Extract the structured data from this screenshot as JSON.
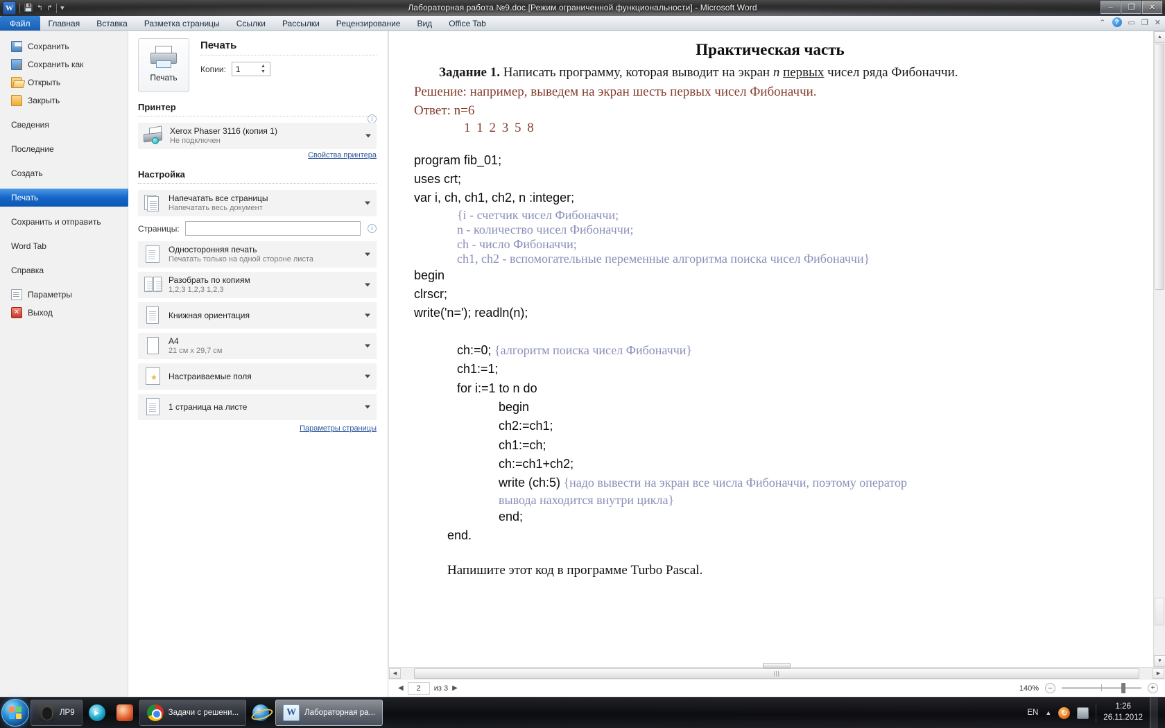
{
  "window": {
    "title": "Лабораторная работа №9.doc [Режим ограниченной функциональности]  -  Microsoft Word",
    "minimize": "–",
    "restore": "❐",
    "close": "✕"
  },
  "quick_access": {
    "orb": "W",
    "save": "💾",
    "undo": "↰",
    "redo": "↱",
    "more": "▾"
  },
  "ribbon": {
    "tabs": [
      {
        "label": "Файл",
        "active": true
      },
      {
        "label": "Главная",
        "active": false
      },
      {
        "label": "Вставка",
        "active": false
      },
      {
        "label": "Разметка страницы",
        "active": false
      },
      {
        "label": "Ссылки",
        "active": false
      },
      {
        "label": "Рассылки",
        "active": false
      },
      {
        "label": "Рецензирование",
        "active": false
      },
      {
        "label": "Вид",
        "active": false
      },
      {
        "label": "Office Tab",
        "active": false
      }
    ],
    "collapse": "⌃",
    "help": "?",
    "min": "▭",
    "restore": "❐",
    "close": "✕"
  },
  "backstage_nav": {
    "items": [
      {
        "label": "Сохранить",
        "icon": "save-icon",
        "selected": false
      },
      {
        "label": "Сохранить как",
        "icon": "save-as-icon",
        "selected": false
      },
      {
        "label": "Открыть",
        "icon": "open-folder-icon",
        "selected": false
      },
      {
        "label": "Закрыть",
        "icon": "close-folder-icon",
        "selected": false
      },
      {
        "label": "Сведения",
        "icon": "",
        "selected": false
      },
      {
        "label": "Последние",
        "icon": "",
        "selected": false
      },
      {
        "label": "Создать",
        "icon": "",
        "selected": false
      },
      {
        "label": "Печать",
        "icon": "",
        "selected": true
      },
      {
        "label": "Сохранить и отправить",
        "icon": "",
        "selected": false
      },
      {
        "label": "Word Tab",
        "icon": "",
        "selected": false
      },
      {
        "label": "Справка",
        "icon": "",
        "selected": false
      },
      {
        "label": "Параметры",
        "icon": "options-icon",
        "selected": false
      },
      {
        "label": "Выход",
        "icon": "exit-icon",
        "selected": false
      }
    ]
  },
  "print_panel": {
    "heading": "Печать",
    "print_button_label": "Печать",
    "copies_label": "Копии:",
    "copies_value": "1",
    "printer_heading": "Принтер",
    "printer_name": "Xerox Phaser 3116 (копия 1)",
    "printer_status": "Не подключен",
    "printer_properties_link": "Свойства принтера",
    "settings_heading": "Настройка",
    "options": [
      {
        "title": "Напечатать все страницы",
        "subtitle": "Напечатать весь документ",
        "icon": "pages-icon"
      },
      {
        "title": "Односторонняя печать",
        "subtitle": "Печатать только на одной стороне листа",
        "icon": "one-sided-icon"
      },
      {
        "title": "Разобрать по копиям",
        "subtitle": "1,2,3   1,2,3   1,2,3",
        "icon": "collate-icon"
      },
      {
        "title": "Книжная ориентация",
        "subtitle": "",
        "icon": "portrait-icon"
      },
      {
        "title": "A4",
        "subtitle": "21 см x 29,7 см",
        "icon": "paper-size-icon"
      },
      {
        "title": "Настраиваемые поля",
        "subtitle": "",
        "icon": "margins-icon"
      },
      {
        "title": "1 страница на листе",
        "subtitle": "",
        "icon": "pages-per-sheet-icon"
      }
    ],
    "pages_label": "Страницы:",
    "pages_value": "",
    "page_setup_link": "Параметры страницы",
    "info_glyph": "i"
  },
  "document": {
    "title": "Практическая часть",
    "task_prefix": "Задание 1.",
    "task_text_1": "Написать программу, которая выводит на экран",
    "task_italic": "n",
    "task_underlined": "первых",
    "task_text_2": "чисел ряда Фибоначчи.",
    "solution_line": "Решение: например, выведем на экран шесть первых чисел Фибоначчи.",
    "answer_line": "Ответ: n=6",
    "fib_sequence": "1 1 2 3 5 8",
    "code_lines": [
      {
        "text": "program fib_01;",
        "indent": 0,
        "type": "code"
      },
      {
        "text": "uses crt;",
        "indent": 0,
        "type": "code"
      },
      {
        "text": "var i, ch, ch1, ch2, n :integer;",
        "indent": 0,
        "type": "code"
      },
      {
        "text": "{i - счетчик чисел Фибоначчи;",
        "indent": 1,
        "type": "comment"
      },
      {
        "text": "n - количество чисел Фибоначчи;",
        "indent": 1,
        "type": "comment"
      },
      {
        "text": "ch - число Фибоначчи;",
        "indent": 1,
        "type": "comment"
      },
      {
        "text": "ch1, ch2 - вспомогательные переменные алгоритма поиска чисел Фибоначчи}",
        "indent": 1,
        "type": "comment"
      },
      {
        "text": "begin",
        "indent": 0,
        "type": "code"
      },
      {
        "text": "clrscr;",
        "indent": 0,
        "type": "code"
      },
      {
        "text": "write('n='); readln(n);",
        "indent": 0,
        "type": "code"
      },
      {
        "text": "",
        "indent": 0,
        "type": "blank"
      },
      {
        "text": "ch:=0;",
        "indent": 1,
        "type": "code",
        "comment": " {алгоритм поиска чисел Фибоначчи}"
      },
      {
        "text": "ch1:=1;",
        "indent": 1,
        "type": "code"
      },
      {
        "text": "for i:=1 to n do",
        "indent": 1,
        "type": "code"
      },
      {
        "text": "begin",
        "indent": 2,
        "type": "code"
      },
      {
        "text": "ch2:=ch1;",
        "indent": 2,
        "type": "code"
      },
      {
        "text": "ch1:=ch;",
        "indent": 2,
        "type": "code"
      },
      {
        "text": "ch:=ch1+ch2;",
        "indent": 2,
        "type": "code"
      },
      {
        "text": "write (ch:5)",
        "indent": 2,
        "type": "code",
        "comment": " {надо вывести на экран все числа Фибоначчи, поэтому оператор"
      },
      {
        "text": "вывода находится внутри цикла}",
        "indent": 2,
        "type": "comment"
      },
      {
        "text": "end;",
        "indent": 2,
        "type": "code"
      },
      {
        "text": "end.",
        "indent": 3,
        "type": "code"
      }
    ],
    "closing_line": "Напишите этот код в программе Turbo Pascal."
  },
  "status_bar": {
    "page_current": "2",
    "page_of": "из 3",
    "prev_arrow": "◀",
    "next_arrow": "▶",
    "zoom_percent": "140%",
    "zoom_out": "–",
    "zoom_in": "+"
  },
  "scrollbars": {
    "up_arrow": "▲",
    "down_arrow": "▼",
    "left_arrow": "◀",
    "right_arrow": "▶",
    "grip": "|||"
  },
  "taskbar": {
    "start_tooltip": "Пуск",
    "items": [
      {
        "label": "ЛР9",
        "icon": "folder-dark-icon",
        "state": "group"
      },
      {
        "label": "",
        "icon": "media-player-icon",
        "state": "plain"
      },
      {
        "label": "",
        "icon": "ccleaner-icon",
        "state": "plain"
      },
      {
        "label": "Задачи с решени...",
        "icon": "chrome-icon",
        "state": "group"
      },
      {
        "label": "",
        "icon": "ie-icon",
        "state": "plain"
      },
      {
        "label": "Лабораторная ра...",
        "icon": "word-icon",
        "state": "active"
      }
    ],
    "tray": {
      "language": "EN",
      "chevron": "▲",
      "updater_icon": "update-icon",
      "network_icon": "network-icon",
      "time": "1:26",
      "date": "26.11.2012"
    }
  }
}
